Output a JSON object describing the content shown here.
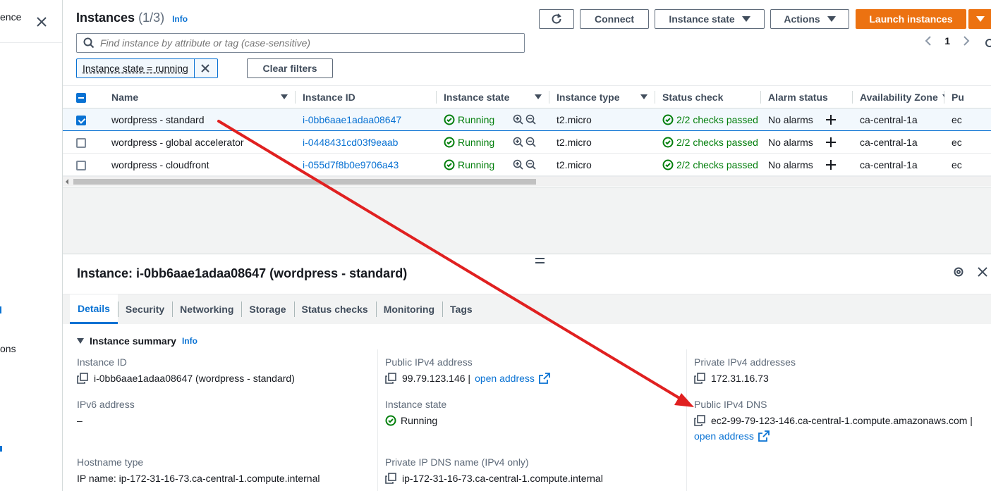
{
  "sidebar": {
    "fragments": [
      "ence",
      "ons"
    ]
  },
  "header": {
    "title": "Instances",
    "count": "(1/3)",
    "info": "Info",
    "connect_label": "Connect",
    "instance_state_label": "Instance state",
    "actions_label": "Actions",
    "launch_label": "Launch instances",
    "search_placeholder": "Find instance by attribute or tag (case-sensitive)",
    "page_number": "1",
    "filter_token": "Instance state = running",
    "clear_filters_label": "Clear filters"
  },
  "table": {
    "columns": [
      "Name",
      "Instance ID",
      "Instance state",
      "Instance type",
      "Status check",
      "Alarm status",
      "Availability Zone",
      "Pu"
    ],
    "rows": [
      {
        "selected": true,
        "name": "wordpress - standard",
        "id": "i-0bb6aae1adaa08647",
        "state": "Running",
        "type": "t2.micro",
        "status": "2/2 checks passed",
        "alarm": "No alarms",
        "az": "ca-central-1a",
        "extra": "ec"
      },
      {
        "selected": false,
        "name": "wordpress - global accelerator",
        "id": "i-0448431cd03f9eaab",
        "state": "Running",
        "type": "t2.micro",
        "status": "2/2 checks passed",
        "alarm": "No alarms",
        "az": "ca-central-1a",
        "extra": "ec"
      },
      {
        "selected": false,
        "name": "wordpress - cloudfront",
        "id": "i-055d7f8b0e9706a43",
        "state": "Running",
        "type": "t2.micro",
        "status": "2/2 checks passed",
        "alarm": "No alarms",
        "az": "ca-central-1a",
        "extra": "ec"
      }
    ]
  },
  "panel": {
    "title": "Instance: i-0bb6aae1adaa08647 (wordpress - standard)",
    "tabs": [
      "Details",
      "Security",
      "Networking",
      "Storage",
      "Status checks",
      "Monitoring",
      "Tags"
    ],
    "summary_label": "Instance summary",
    "summary_info": "Info",
    "fields": {
      "instance_id_label": "Instance ID",
      "instance_id_value": "i-0bb6aae1adaa08647 (wordpress - standard)",
      "ipv6_label": "IPv6 address",
      "ipv6_value": "–",
      "hostname_label": "Hostname type",
      "hostname_value": "IP name: ip-172-31-16-73.ca-central-1.compute.internal",
      "public_ipv4_label": "Public IPv4 address",
      "public_ipv4_value": "99.79.123.146 |",
      "open_address": "open address",
      "instance_state_label": "Instance state",
      "instance_state_value": "Running",
      "private_dns_label": "Private IP DNS name (IPv4 only)",
      "private_dns_value": "ip-172-31-16-73.ca-central-1.compute.internal",
      "private_ipv4_label": "Private IPv4 addresses",
      "private_ipv4_value": "172.31.16.73",
      "public_dns_label": "Public IPv4 DNS",
      "public_dns_value": "ec2-99-79-123-146.ca-central-1.compute.amazonaws.com |"
    }
  },
  "colors": {
    "accent": "#0972d3",
    "launch": "#ec7211",
    "success": "#037f0c",
    "annotation_arrow": "#e02020"
  },
  "icons": [
    "close-icon",
    "refresh-icon",
    "search-icon",
    "caret-down-icon",
    "chevron-left-icon",
    "chevron-right-icon",
    "settings-icon",
    "zoom-in-icon",
    "zoom-out-icon",
    "check-circle-icon",
    "plus-icon",
    "copy-icon",
    "external-link-icon"
  ]
}
